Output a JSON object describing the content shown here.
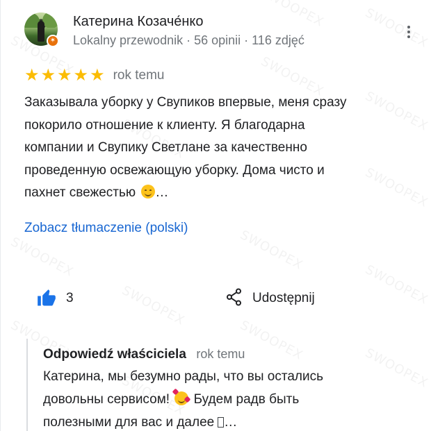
{
  "author": {
    "name": "Катерина Козаче́нко",
    "meta": "Lokalny przewodnik · 56 opinii · 116 zdjęć"
  },
  "rating": {
    "stars": 5,
    "time": "rok temu"
  },
  "review": {
    "lines": [
      "Заказывала уборку у Свупиков впервые, меня сразу",
      "покорило отношение к клиенту. Я благодарна",
      "компании и Свупику Светлане  за качественно",
      "проведенную освежающую уборку. Дома чисто и",
      "пахнет свежестью"
    ],
    "ellipsis": "…"
  },
  "translate_link": "Zobacz tłumaczenie (polski)",
  "actions": {
    "like_count": "3",
    "share_label": "Udostępnij"
  },
  "owner_reply": {
    "title": "Odpowiedź właściciela",
    "time": "rok temu",
    "line1": "Катерина, мы безумно рады, что вы остались",
    "line2_a": "довольны сервисом!",
    "line2_b": "Будем радв быть",
    "line3": "полезными для вас и далее",
    "ellipsis": "…"
  },
  "watermark": "SWOOPEX",
  "colors": {
    "star": "#fbbc04",
    "link": "#1967d2",
    "like_icon": "#1a73e8",
    "secondary_text": "#70757a"
  }
}
